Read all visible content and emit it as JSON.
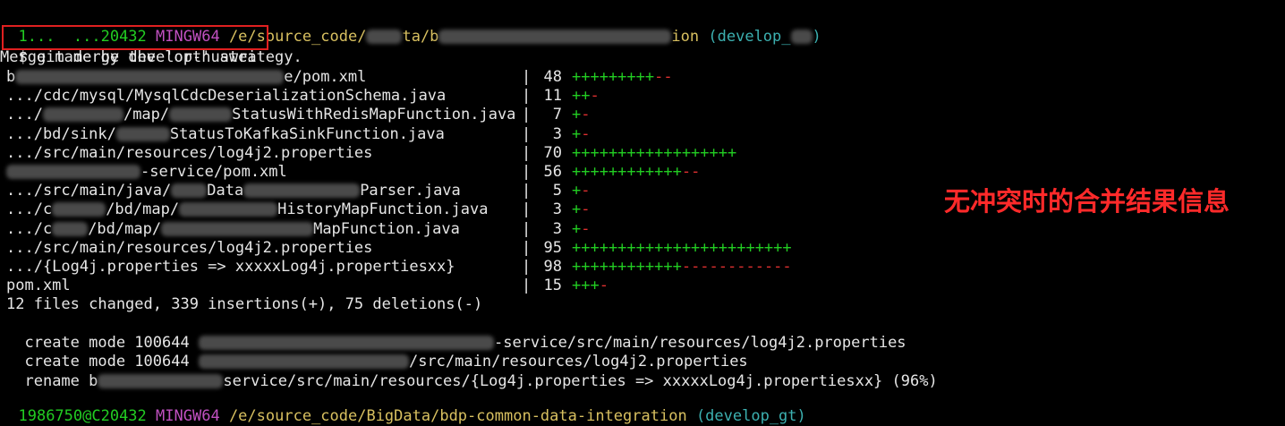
{
  "prompt_top": {
    "user": "1...  ...20432",
    "host": "MINGW64",
    "path": "/e/source_code/",
    "path_tail": "ta/b",
    "path_end": "ion",
    "branch": "(develop_",
    "branch_end": ")"
  },
  "command": {
    "dollar": "$",
    "text": "git merge develop-huawei"
  },
  "merge_msg": "Merge made by the 'ort' strategy.",
  "stat_rows": [
    {
      "path": "b",
      "path_tail": "e/pom.xml",
      "count": "48",
      "plus": "+++++++++",
      "minus": "--"
    },
    {
      "path": ".../cdc/mysql/MysqlCdcDeserializationSchema.java",
      "path_tail": "",
      "count": "11",
      "plus": "++",
      "minus": "-"
    },
    {
      "path": ".../",
      "path_mid": "/map/",
      "path_tail": "StatusWithRedisMapFunction.java",
      "count": "7",
      "plus": "+",
      "minus": "-"
    },
    {
      "path": ".../bd/sink/",
      "path_tail": "StatusToKafkaSinkFunction.java",
      "count": "3",
      "plus": "+",
      "minus": "-"
    },
    {
      "path": ".../src/main/resources/log4j2.properties",
      "path_tail": "",
      "count": "70",
      "plus": "++++++++++++++++++",
      "minus": ""
    },
    {
      "path": "",
      "path_tail": "-service/pom.xml",
      "count": "56",
      "plus": "++++++++++++",
      "minus": "--"
    },
    {
      "path": ".../src/main/java/",
      "path_mid": "Data",
      "path_tail": "Parser.java",
      "count": "5",
      "plus": "+",
      "minus": "-"
    },
    {
      "path": ".../c",
      "path_mid": "/bd/map/",
      "path_tail": "HistoryMapFunction.java",
      "count": "3",
      "plus": "+",
      "minus": "-"
    },
    {
      "path": ".../c",
      "path_mid": "/bd/map/",
      "path_tail": "MapFunction.java",
      "count": "3",
      "plus": "+",
      "minus": "-"
    },
    {
      "path": ".../src/main/resources/log4j2.properties",
      "path_tail": "",
      "count": "95",
      "plus": "++++++++++++++++++++++++",
      "minus": ""
    },
    {
      "path": ".../{Log4j.properties => xxxxxLog4j.propertiesxx}",
      "path_tail": "",
      "count": "98",
      "plus": "++++++++++++",
      "minus": "------------"
    },
    {
      "path": "pom.xml",
      "path_tail": "",
      "count": "15",
      "plus": "+++",
      "minus": "-"
    }
  ],
  "summary": "12 files changed, 339 insertions(+), 75 deletions(-)",
  "create1": {
    "prefix": "create mode 100644",
    "tail": "-service/src/main/resources/log4j2.properties"
  },
  "create2": {
    "prefix": "create mode 100644",
    "tail": "/src/main/resources/log4j2.properties"
  },
  "rename": {
    "prefix": "rename b",
    "tail": "service/src/main/resources/{Log4j.properties => xxxxxLog4j.propertiesxx} (96%)"
  },
  "prompt_bottom": {
    "user": "1986750@C20432",
    "host": "MINGW64",
    "path": "/e/source_code/BigData/bdp-common-data-integration",
    "branch": "(develop_gt)"
  },
  "annotation": "无冲突时的合并结果信息",
  "colors": {
    "background": "#000000",
    "text": "#e6e6e6",
    "plus": "#22cc22",
    "minus": "#e03030",
    "highlight_box": "#e02020",
    "annotation": "#ff2a2a"
  }
}
